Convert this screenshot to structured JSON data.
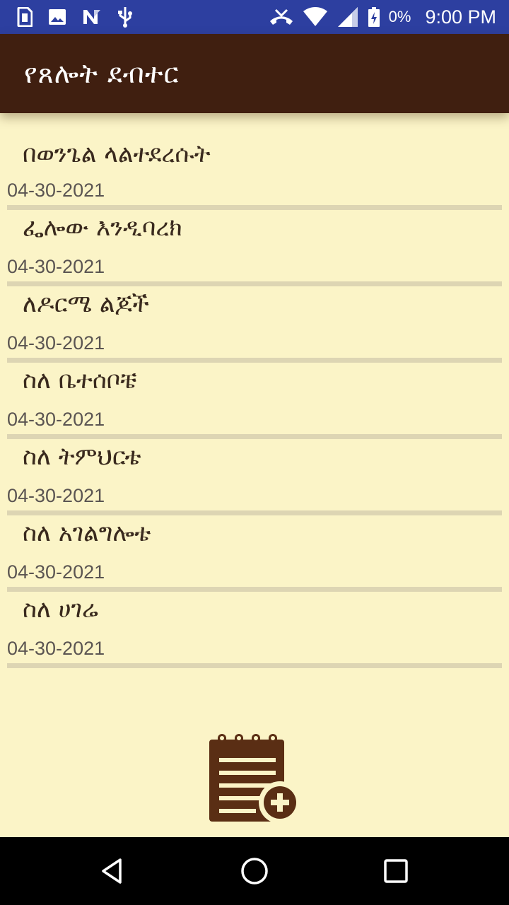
{
  "status_bar": {
    "left_icons": [
      "sim-card-icon",
      "image-icon",
      "n-notification-icon",
      "usb-icon"
    ],
    "right_icons": [
      "missed-call-icon",
      "wifi-icon",
      "signal-icon",
      "battery-charging-icon"
    ],
    "battery_percent": "0%",
    "time": "9:00 PM"
  },
  "app_bar": {
    "title": "የጸሎት ደብተር"
  },
  "notes": [
    {
      "title": "በወንጌል ላልተደረሱት",
      "date": "04-30-2021"
    },
    {
      "title": "ፌሎው እንዲባረክ",
      "date": "04-30-2021"
    },
    {
      "title": "ለዶርሜ ልጆች",
      "date": "04-30-2021"
    },
    {
      "title": "ስለ ቤተሰቦቼ",
      "date": "04-30-2021"
    },
    {
      "title": "ስለ ትምህርቴ",
      "date": "04-30-2021"
    },
    {
      "title": "ስለ አገልግሎቴ",
      "date": "04-30-2021"
    },
    {
      "title": "ስለ ሀገሬ",
      "date": "04-30-2021"
    }
  ],
  "fab": {
    "icon": "notepad-add-icon"
  },
  "nav_bar": {
    "buttons": [
      "back-icon",
      "home-icon",
      "recents-icon"
    ]
  },
  "colors": {
    "status_bar": "#2d3fa0",
    "app_bar": "#401f10",
    "background": "#fbf4c7",
    "divider": "#ddd5b3",
    "icon_brown": "#5a2e14"
  }
}
